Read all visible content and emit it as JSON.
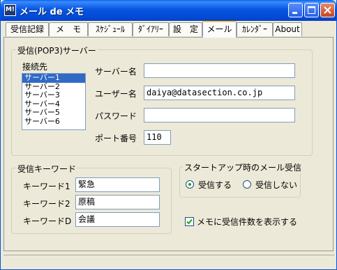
{
  "window": {
    "title": "メール de メモ",
    "icon_text": "M!",
    "accent": "#0054e3",
    "buttons": [
      "minimize-icon",
      "maximize-icon",
      "close-icon"
    ]
  },
  "tabs": [
    {
      "label": "受信記録",
      "active": false
    },
    {
      "label": "メ　モ",
      "active": false
    },
    {
      "label": "ｽｹｼﾞｭｰﾙ",
      "active": false
    },
    {
      "label": "ﾀﾞｲｱﾘｰ",
      "active": false
    },
    {
      "label": "設　定",
      "active": false
    },
    {
      "label": "メール",
      "active": true
    },
    {
      "label": "ｶﾚﾝﾀﾞｰ",
      "active": false
    },
    {
      "label": "About",
      "active": false
    }
  ],
  "server_group": {
    "title": "受信(POP3)サーバー",
    "connection_label": "接続先",
    "servers": [
      "サーバー1",
      "サーバー2",
      "サーバー3",
      "サーバー4",
      "サーバー5",
      "サーバー6"
    ],
    "selected_server": "サーバー1",
    "server_name_label": "サーバー名",
    "server_name_value": "",
    "username_label": "ユーザー名",
    "username_value": "daiya@datasection.co.jp",
    "password_label": "パスワード",
    "password_value": "",
    "port_label": "ポート番号",
    "port_value": "110"
  },
  "keyword_group": {
    "title": "受信キーワード",
    "keywords": [
      {
        "label": "キーワード1",
        "value": "緊急"
      },
      {
        "label": "キーワード2",
        "value": "原稿"
      },
      {
        "label": "キーワードD",
        "value": "会議"
      }
    ]
  },
  "startup_group": {
    "title": "スタートアップ時のメール受信",
    "options": [
      {
        "label": "受信する",
        "selected": true
      },
      {
        "label": "受信しない",
        "selected": false
      }
    ]
  },
  "show_count_checkbox": {
    "label": "メモに受信件数を表示する",
    "checked": true
  }
}
